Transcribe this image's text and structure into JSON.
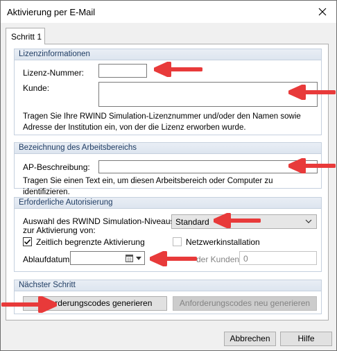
{
  "window": {
    "title": "Aktivierung per E-Mail"
  },
  "tab": {
    "label": "Schritt 1"
  },
  "license": {
    "header": "Lizenzinformationen",
    "number_label": "Lizenz-Nummer:",
    "number_value": "",
    "customer_label": "Kunde:",
    "customer_value": "",
    "help": "Tragen Sie Ihre RWIND Simulation-Lizenznummer und/oder den Namen sowie Adresse der Institution ein, von der die Lizenz erworben wurde."
  },
  "workspace": {
    "header": "Bezeichnung des Arbeitsbereichs",
    "desc_label": "AP-Beschreibung:",
    "desc_value": "",
    "help": "Tragen Sie einen Text ein, um diesen Arbeitsbereich oder Computer zu identifizieren."
  },
  "auth": {
    "header": "Erforderliche Autorisierung",
    "level_label_1": "Auswahl des RWIND Simulation-Niveaus",
    "level_label_2": "zur Aktivierung von:",
    "level_value": "Standard",
    "timed_label": "Zeitlich begrenzte Aktivierung",
    "timed_checked": true,
    "network_label": "Netzwerkinstallation",
    "network_checked": false,
    "expiry_label": "Ablaufdatum:",
    "expiry_value": "",
    "clients_label": "der Kunden:",
    "clients_value": "0"
  },
  "next": {
    "header": "Nächster Schritt",
    "generate_label": "Anforderungscodes generieren",
    "regenerate_label": "Anforderungscodes neu generieren"
  },
  "footer": {
    "cancel_label": "Abbrechen",
    "help_label": "Hilfe"
  },
  "colors": {
    "arrow": "#e83a3a",
    "group_header_text": "#1f3c63"
  }
}
